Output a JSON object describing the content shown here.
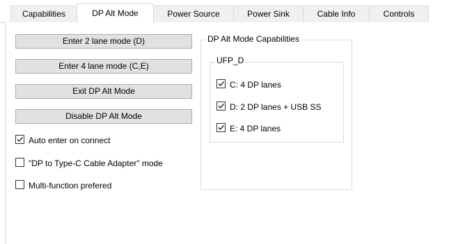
{
  "tabs": [
    {
      "label": "Capabilities"
    },
    {
      "label": "DP Alt Mode"
    },
    {
      "label": "Power Source"
    },
    {
      "label": "Power Sink"
    },
    {
      "label": "Cable Info"
    },
    {
      "label": "Controls"
    }
  ],
  "selected_tab": "DP Alt Mode",
  "buttons": {
    "enter_2_lane": "Enter 2 lane mode (D)",
    "enter_4_lane": "Enter 4 lane mode (C,E)",
    "exit_dp": "Exit DP Alt Mode",
    "disable_dp": "Disable DP Alt Mode"
  },
  "options": [
    {
      "label": "Auto enter on connect",
      "checked": true
    },
    {
      "label": "\"DP to Type-C Cable Adapter\" mode",
      "checked": false
    },
    {
      "label": "Multi-function prefered",
      "checked": false
    }
  ],
  "capabilities": {
    "title": "DP Alt Mode Capabilities",
    "ufp_title": "UFP_D",
    "items": [
      {
        "label": "C: 4 DP lanes",
        "checked": true
      },
      {
        "label": "D: 2 DP lanes + USB SS",
        "checked": true
      },
      {
        "label": "E: 4 DP lanes",
        "checked": true
      }
    ]
  },
  "colors": {
    "tab_border": "#d9d9d9",
    "button_face": "#e1e1e1",
    "button_border": "#adadad"
  }
}
